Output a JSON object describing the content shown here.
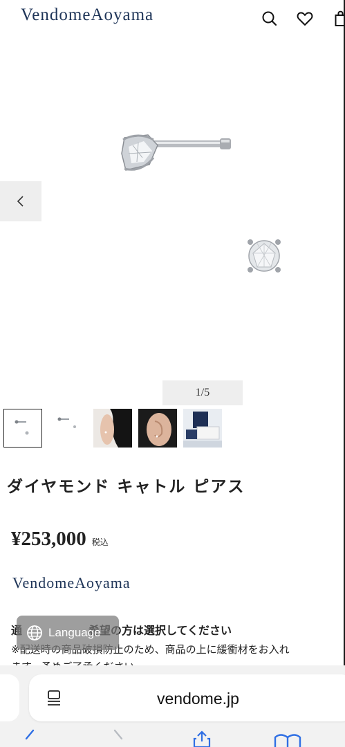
{
  "header": {
    "logo": "VendomeAoyama",
    "icons": [
      "search-icon",
      "heart-icon",
      "shopping-bag-icon"
    ]
  },
  "gallery": {
    "counter": "1/5",
    "prev_icon": "chevron-left-icon"
  },
  "thumbnails": [
    "stud-earring-side-and-front",
    "stud-earring-small",
    "model-ear-wearing",
    "ear-closeup",
    "gift-box-packaging"
  ],
  "product": {
    "title": "ダイヤモンド キャトル ピアス",
    "price": "¥253,000",
    "tax_label": "税込",
    "brand": "VendomeAoyama"
  },
  "notes": {
    "line1": "通　　　　　　希望の方は選択してください",
    "line2": "※配送時の商品破損防止のため、商品の上に緩衝材をお入れ",
    "line3": "ます。予めご了承ください"
  },
  "language_button": {
    "label": "Language",
    "icon": "globe-icon"
  },
  "browser": {
    "url": "vendome.jp",
    "toolbar": [
      "back-icon",
      "forward-icon",
      "share-icon",
      "bookmarks-icon"
    ]
  },
  "colors": {
    "brand_navy": "#1f3558",
    "panel_gray": "#eeeeee",
    "bar_gray": "#f2f2f2"
  }
}
